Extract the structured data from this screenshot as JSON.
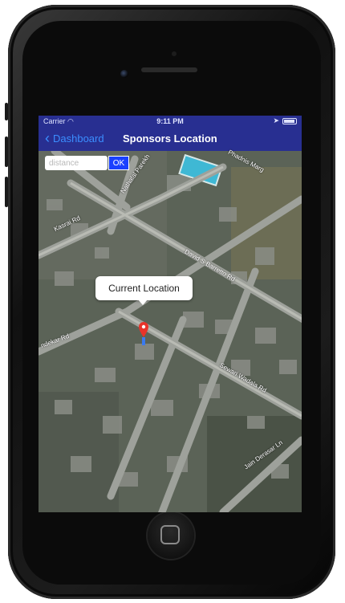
{
  "status": {
    "carrier": "Carrier",
    "time": "9:11 PM"
  },
  "nav": {
    "back_label": "Dashboard",
    "title": "Sponsors Location"
  },
  "search": {
    "placeholder": "distance",
    "ok_label": "OK"
  },
  "map": {
    "callout": "Current Location",
    "roads": [
      "Kasrai Rd",
      "David S Barretto Rd",
      "Sewari Wadala Rd",
      "Jain Derasar Ln",
      "Nathalal Parekh",
      "Phadnis Marg",
      "ndekar Rd"
    ]
  },
  "colors": {
    "bar": "#282f91",
    "back_link": "#3b8eff",
    "ok_button": "#1a40ff"
  }
}
